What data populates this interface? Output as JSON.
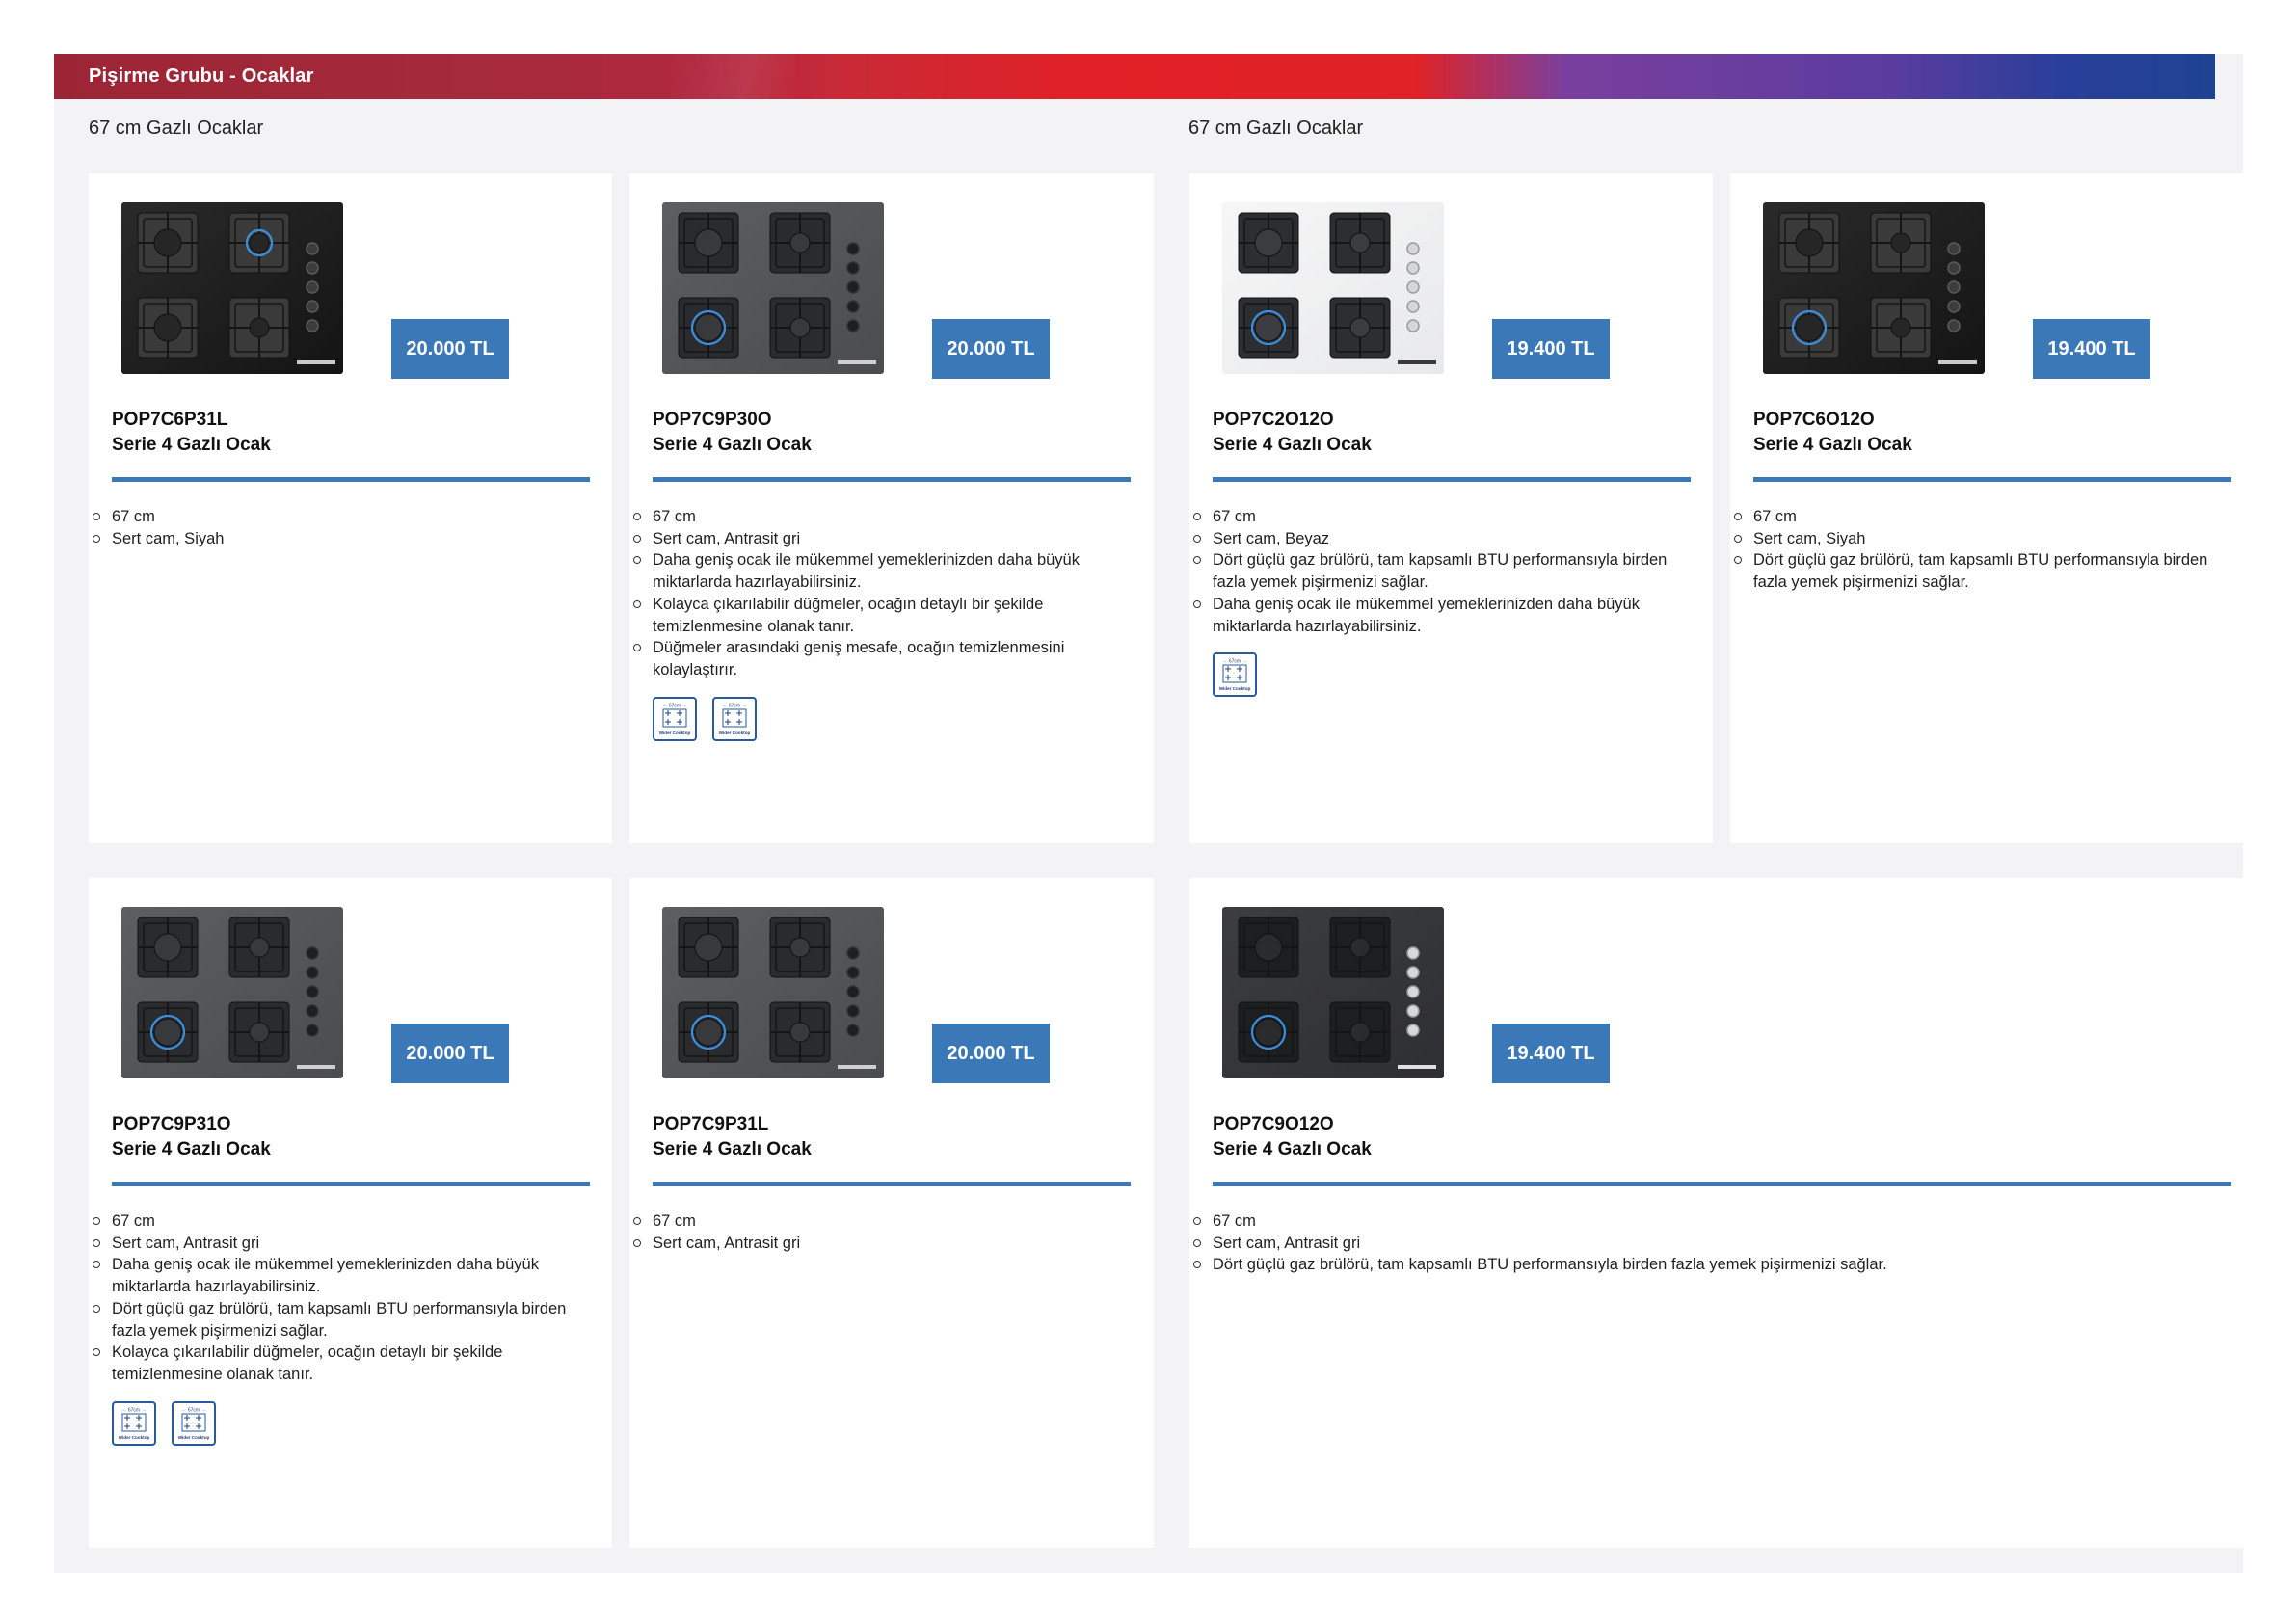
{
  "header": {
    "title": "Pişirme Grubu - Ocaklar"
  },
  "sections": [
    {
      "title": "67 cm Gazlı Ocaklar"
    },
    {
      "title": "67 cm Gazlı Ocaklar"
    }
  ],
  "badge_label": "Wider Cooktop",
  "badge_size": "67cm",
  "products": [
    {
      "code": "POP7C6P31L",
      "name": "Serie 4 Gazlı Ocak",
      "price": "20.000 TL",
      "finish": "black",
      "features": [
        "67 cm",
        "Sert cam, Siyah"
      ],
      "badges": 0
    },
    {
      "code": "POP7C9P30O",
      "name": "Serie 4 Gazlı Ocak",
      "price": "20.000 TL",
      "finish": "anthracite",
      "features": [
        "67 cm",
        "Sert cam, Antrasit gri",
        "Daha geniş ocak ile mükemmel yemeklerinizden daha büyük miktarlarda hazırlayabilirsiniz.",
        "Kolayca çıkarılabilir düğmeler, ocağın detaylı bir şekilde temizlenmesine olanak tanır.",
        "Düğmeler arasındaki geniş mesafe, ocağın temizlenmesini kolaylaştırır."
      ],
      "badges": 2
    },
    {
      "code": "POP7C2O12O",
      "name": "Serie 4 Gazlı Ocak",
      "price": "19.400 TL",
      "finish": "white",
      "features": [
        "67 cm",
        "Sert cam, Beyaz",
        "Dört güçlü gaz brülörü, tam kapsamlı BTU performansıyla birden fazla yemek pişirmenizi sağlar.",
        "Daha geniş ocak ile mükemmel yemeklerinizden daha büyük miktarlarda hazırlayabilirsiniz."
      ],
      "badges": 1
    },
    {
      "code": "POP7C6O12O",
      "name": "Serie 4 Gazlı Ocak",
      "price": "19.400 TL",
      "finish": "black",
      "features": [
        "67 cm",
        "Sert cam, Siyah",
        "Dört güçlü gaz brülörü, tam kapsamlı BTU performansıyla birden fazla yemek pişirmenizi sağlar."
      ],
      "badges": 0
    },
    {
      "code": "POP7C9P31O",
      "name": "Serie 4 Gazlı Ocak",
      "price": "20.000 TL",
      "finish": "anthracite",
      "features": [
        "67 cm",
        "Sert cam, Antrasit gri",
        "Daha geniş ocak ile mükemmel yemeklerinizden daha büyük miktarlarda hazırlayabilirsiniz.",
        "Dört güçlü gaz brülörü, tam kapsamlı BTU performansıyla birden fazla yemek pişirmenizi sağlar.",
        "Kolayca çıkarılabilir düğmeler, ocağın detaylı bir şekilde temizlenmesine olanak tanır."
      ],
      "badges": 2
    },
    {
      "code": "POP7C9P31L",
      "name": "Serie 4 Gazlı Ocak",
      "price": "20.000 TL",
      "finish": "anthracite",
      "features": [
        "67 cm",
        "Sert cam, Antrasit gri"
      ],
      "badges": 0
    },
    {
      "code": "POP7C9O12O",
      "name": "Serie 4 Gazlı Ocak",
      "price": "19.400 TL",
      "finish": "anthracite-dark",
      "features": [
        "67 cm",
        "Sert cam, Antrasit gri",
        "Dört güçlü gaz brülörü, tam kapsamlı BTU performansıyla birden fazla yemek pişirmenizi sağlar."
      ],
      "badges": 0
    }
  ]
}
